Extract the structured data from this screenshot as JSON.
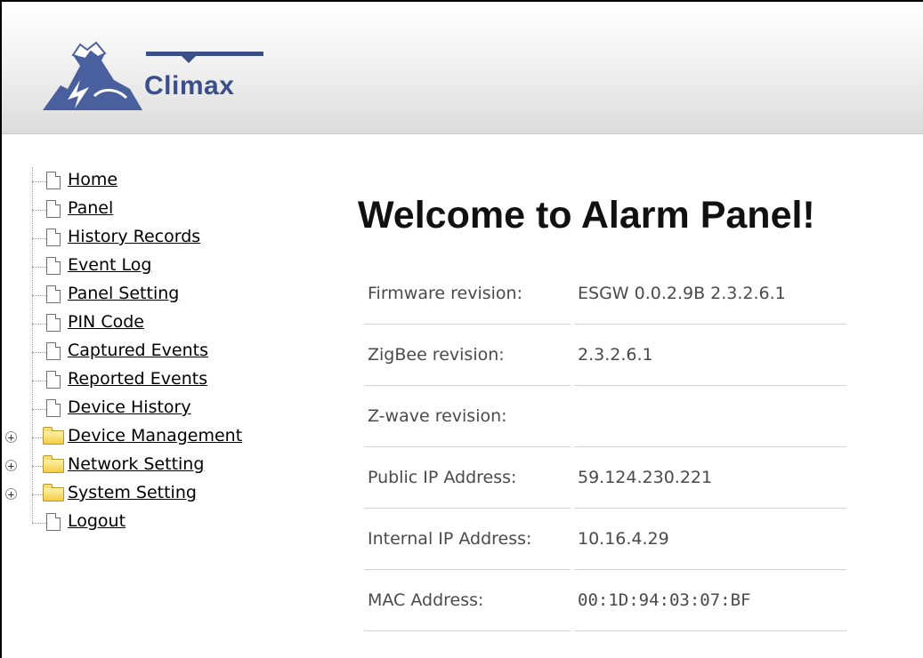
{
  "header": {
    "logo_text": "Climax"
  },
  "sidebar": {
    "items": [
      {
        "label": "Home",
        "type": "page"
      },
      {
        "label": "Panel",
        "type": "page"
      },
      {
        "label": "History Records",
        "type": "page"
      },
      {
        "label": "Event Log",
        "type": "page"
      },
      {
        "label": "Panel Setting",
        "type": "page"
      },
      {
        "label": "PIN Code",
        "type": "page"
      },
      {
        "label": "Captured Events",
        "type": "page"
      },
      {
        "label": "Reported Events",
        "type": "page"
      },
      {
        "label": "Device History",
        "type": "page"
      },
      {
        "label": "Device Management",
        "type": "folder"
      },
      {
        "label": "Network Setting",
        "type": "folder"
      },
      {
        "label": "System Setting",
        "type": "folder"
      },
      {
        "label": "Logout",
        "type": "page"
      }
    ]
  },
  "main": {
    "title": "Welcome to Alarm Panel!",
    "info": [
      {
        "label": "Firmware revision:",
        "value": "ESGW 0.0.2.9B 2.3.2.6.1"
      },
      {
        "label": "ZigBee revision:",
        "value": "2.3.2.6.1"
      },
      {
        "label": "Z-wave revision:",
        "value": ""
      },
      {
        "label": "Public IP Address:",
        "value": "59.124.230.221"
      },
      {
        "label": "Internal IP Address:",
        "value": "10.16.4.29"
      },
      {
        "label": "MAC Address:",
        "value": "00:1D:94:03:07:BF"
      }
    ]
  },
  "colors": {
    "logo_blue": "#3a4f8a",
    "folder_yellow": "#f2cc45"
  }
}
